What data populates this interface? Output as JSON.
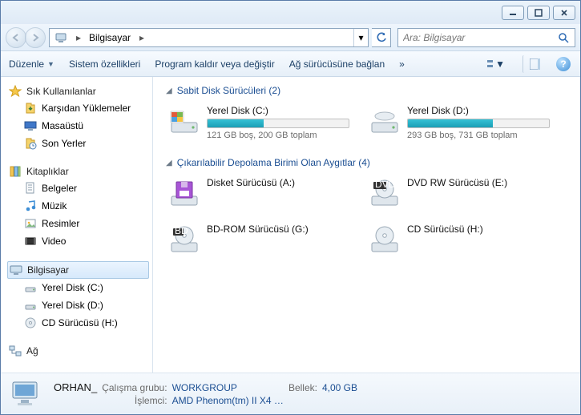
{
  "titlebar": {},
  "nav": {
    "breadcrumb_root": "Bilgisayar",
    "search_placeholder": "Ara: Bilgisayar"
  },
  "toolbar": {
    "organize": "Düzenle",
    "sysprops": "Sistem özellikleri",
    "uninstall": "Program kaldır veya değiştir",
    "mapdrive": "Ağ sürücüsüne bağlan",
    "more": "»"
  },
  "sidebar": {
    "favorites": {
      "label": "Sık Kullanılanlar",
      "items": [
        {
          "label": "Karşıdan Yüklemeler",
          "icon": "download-icon"
        },
        {
          "label": "Masaüstü",
          "icon": "desktop-icon"
        },
        {
          "label": "Son Yerler",
          "icon": "recent-icon"
        }
      ]
    },
    "libraries": {
      "label": "Kitaplıklar",
      "items": [
        {
          "label": "Belgeler",
          "icon": "documents-icon"
        },
        {
          "label": "Müzik",
          "icon": "music-icon"
        },
        {
          "label": "Resimler",
          "icon": "pictures-icon"
        },
        {
          "label": "Video",
          "icon": "video-icon"
        }
      ]
    },
    "computer": {
      "label": "Bilgisayar",
      "items": [
        {
          "label": "Yerel Disk (C:)",
          "icon": "hdd-icon"
        },
        {
          "label": "Yerel Disk (D:)",
          "icon": "hdd-icon"
        },
        {
          "label": "CD Sürücüsü (H:)",
          "icon": "cd-icon"
        }
      ]
    },
    "network": {
      "label": "Ağ"
    }
  },
  "content": {
    "hdd": {
      "header": "Sabit Disk Sürücüleri (2)",
      "drives": [
        {
          "title": "Yerel Disk (C:)",
          "sub": "121 GB boş, 200 GB toplam",
          "fill": 40,
          "icon": "hdd-win-icon"
        },
        {
          "title": "Yerel Disk (D:)",
          "sub": "293 GB boş, 731 GB toplam",
          "fill": 60,
          "icon": "hdd-icon"
        }
      ]
    },
    "removable": {
      "header": "Çıkarılabilir Depolama Birimi Olan Aygıtlar (4)",
      "drives": [
        {
          "title": "Disket Sürücüsü (A:)",
          "icon": "floppy-icon"
        },
        {
          "title": "DVD RW Sürücüsü (E:)",
          "icon": "dvd-icon"
        },
        {
          "title": "BD-ROM Sürücüsü (G:)",
          "icon": "bd-icon"
        },
        {
          "title": "CD Sürücüsü (H:)",
          "icon": "cd-icon"
        }
      ]
    }
  },
  "details": {
    "name": "ORHAN_",
    "workgroup_k": "Çalışma grubu:",
    "workgroup_v": "WORKGROUP",
    "memory_k": "Bellek:",
    "memory_v": "4,00 GB",
    "cpu_k": "İşlemci:",
    "cpu_v": "AMD Phenom(tm) II X4 …"
  }
}
